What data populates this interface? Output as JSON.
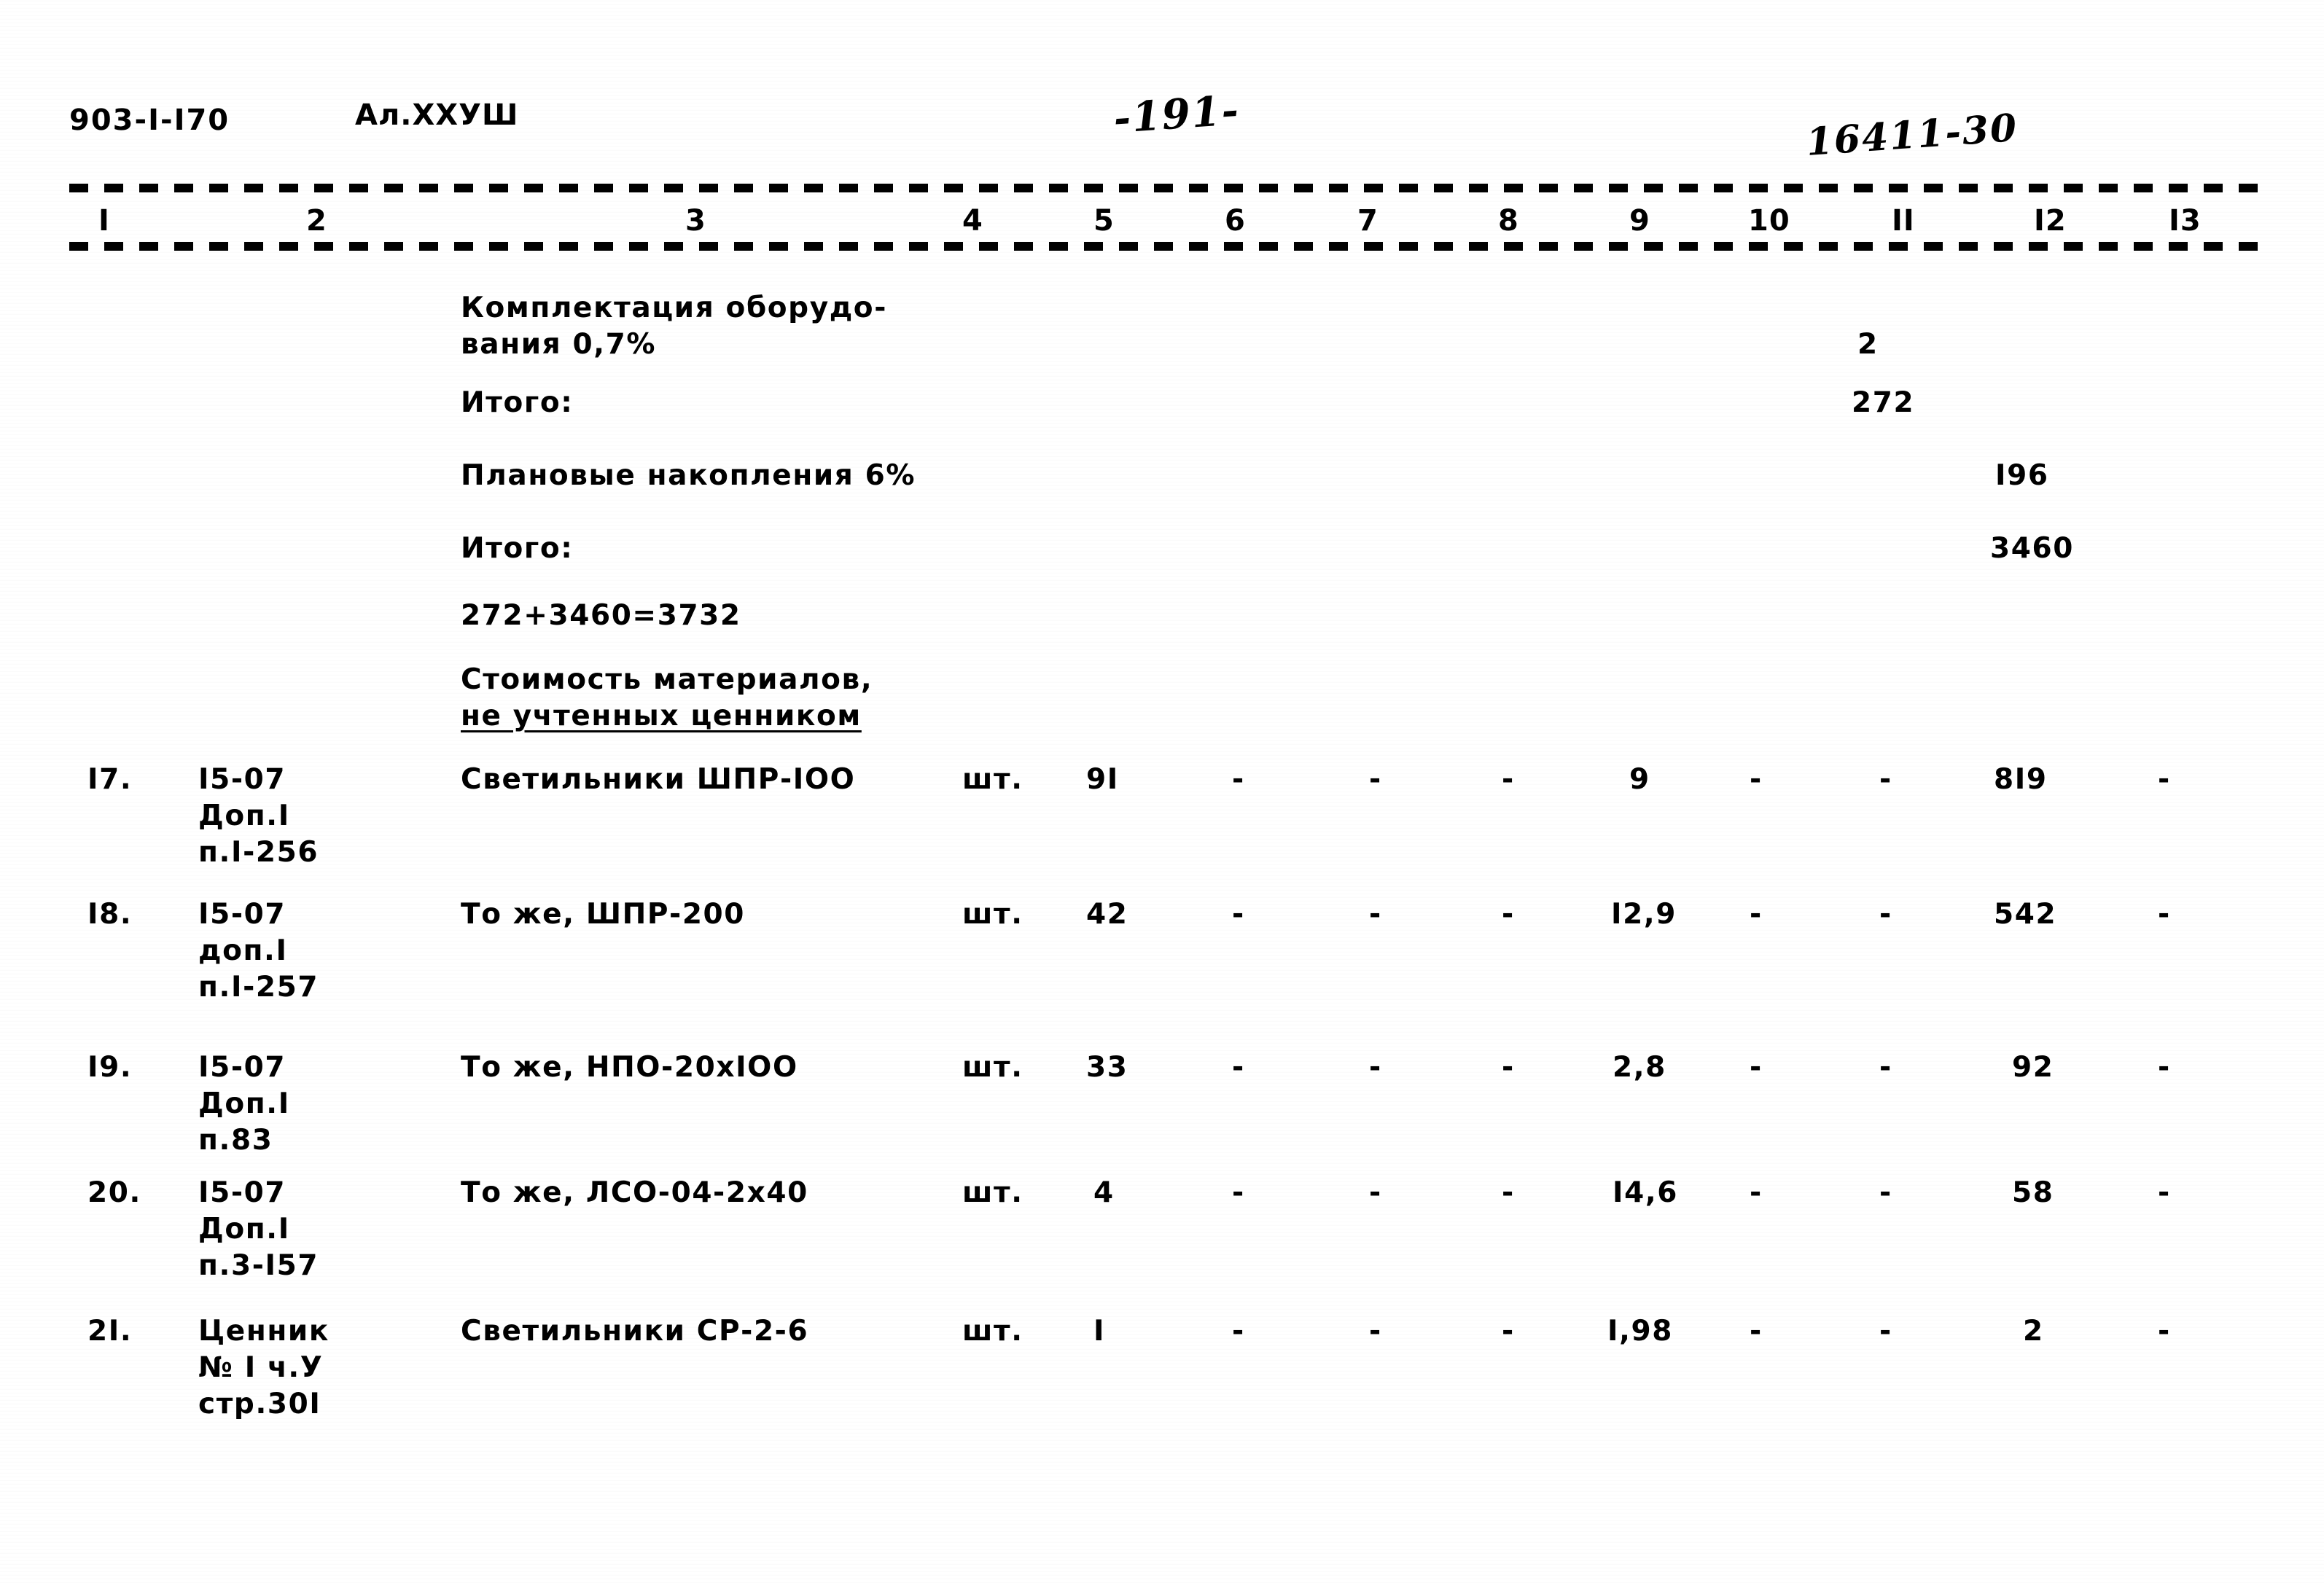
{
  "header": {
    "document_code": "903-I-I70",
    "album": "Ал.XXУШ",
    "page_number_handwritten": "-191-",
    "stamp_handwritten": "16411-30"
  },
  "table": {
    "column_numbers": [
      "I",
      "2",
      "3",
      "4",
      "5",
      "6",
      "7",
      "8",
      "9",
      "10",
      "II",
      "I2",
      "I3"
    ],
    "summary_rows": [
      {
        "description_line1": "Комплектация оборудо-",
        "description_line2": "вания 0,7%",
        "col11": "2",
        "col12": ""
      },
      {
        "description_line1": "Итого:",
        "description_line2": "",
        "col11": "272",
        "col12": ""
      },
      {
        "description_line1": "Плановые накопления 6%",
        "description_line2": "",
        "col11": "",
        "col12": "I96"
      },
      {
        "description_line1": "Итого:",
        "description_line2": "",
        "col11": "",
        "col12": "3460"
      },
      {
        "description_line1": "272+3460=3732",
        "description_line2": "",
        "col11": "",
        "col12": ""
      }
    ],
    "section_heading": {
      "line1": "Стоимость материалов,",
      "line2": "не учтенных ценником"
    },
    "item_rows": [
      {
        "num": "I7.",
        "ref_line1": "I5-07",
        "ref_line2": "Доп.I",
        "ref_line3": "п.I-256",
        "name": "Светильники ШПР-IОО",
        "unit": "шт.",
        "qty": "9I",
        "c6": "-",
        "c7": "-",
        "c8": "-",
        "c9": "9",
        "c10": "-",
        "c11": "-",
        "c12": "8I9",
        "c13": "-"
      },
      {
        "num": "I8.",
        "ref_line1": "I5-07",
        "ref_line2": "доп.I",
        "ref_line3": "п.I-257",
        "name": "То же, ШПР-200",
        "unit": "шт.",
        "qty": "42",
        "c6": "-",
        "c7": "-",
        "c8": "-",
        "c9": "I2,9",
        "c10": "-",
        "c11": "-",
        "c12": "542",
        "c13": "-"
      },
      {
        "num": "I9.",
        "ref_line1": "I5-07",
        "ref_line2": "Доп.I",
        "ref_line3": "п.83",
        "name": "То же, НПО-20хIОО",
        "unit": "шт.",
        "qty": "33",
        "c6": "-",
        "c7": "-",
        "c8": "-",
        "c9": "2,8",
        "c10": "-",
        "c11": "-",
        "c12": "92",
        "c13": "-"
      },
      {
        "num": "20.",
        "ref_line1": "I5-07",
        "ref_line2": "Доп.I",
        "ref_line3": "п.3-I57",
        "name": "То же, ЛСО-04-2х40",
        "unit": "шт.",
        "qty": "4",
        "c6": "-",
        "c7": "-",
        "c8": "-",
        "c9": "I4,6",
        "c10": "-",
        "c11": "-",
        "c12": "58",
        "c13": "-"
      },
      {
        "num": "2I.",
        "ref_line1": "Ценник",
        "ref_line2": "№ I ч.У",
        "ref_line3": "стр.30I",
        "name": "Светильники СР-2-6",
        "unit": "шт.",
        "qty": "I",
        "c6": "-",
        "c7": "-",
        "c8": "-",
        "c9": "I,98",
        "c10": "-",
        "c11": "-",
        "c12": "2",
        "c13": "-"
      }
    ]
  },
  "colors": {
    "ink": "#000000",
    "paper": "#ffffff"
  }
}
